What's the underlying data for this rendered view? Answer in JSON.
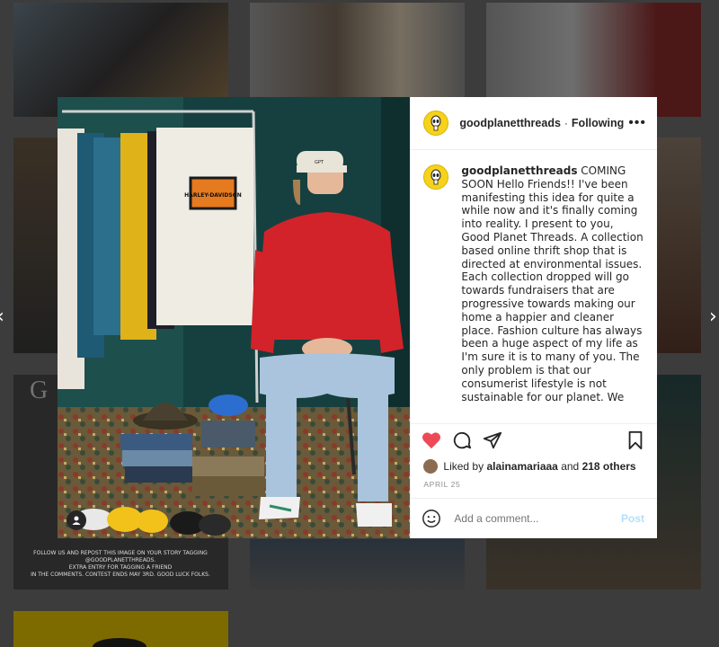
{
  "post": {
    "username": "goodplanetthreads",
    "follow_label": "Following",
    "separator": "·",
    "more_icon": "•••",
    "caption": "COMING SOON Hello Friends!! I've been manifesting this idea for quite a while now and it's finally coming into reality. I present to you, Good Planet Threads. A collection based online thrift shop that is directed at environmental issues. Each collection dropped will go towards fundraisers that are progressive towards making our home a happier and cleaner place. Fashion culture has always been a huge aspect of my life as I'm sure it is to many of you. The only problem is that our consumerist lifestyle is not sustainable for our planet. We",
    "liked_by_prefix": "Liked by",
    "liked_by_user": "alainamariaaa",
    "liked_by_and": "and",
    "liked_by_others": "218 others",
    "date": "APRIL 25",
    "comment_placeholder": "Add a comment...",
    "post_label": "Post"
  },
  "photo": {
    "shirt_logo": "HARLEY-DAVIDSON",
    "hat_text": "GPT"
  },
  "background": {
    "promo_line1": "FOLLOW US AND REPOST THIS IMAGE ON YOUR STORY TAGGING",
    "promo_line2": "@GOODPLANETTHREADS.",
    "promo_line3": "EXTRA ENTRY FOR TAGGING A FRIEND",
    "promo_line4": "IN THE COMMENTS. CONTEST ENDS MAY 3RD. GOOD LUCK FOLKS.",
    "nav_prev": "‹",
    "nav_next": "›",
    "tile_letter": "G"
  },
  "colors": {
    "like_red": "#ed4956",
    "avatar_yellow": "#f6d21a",
    "post_blue": "#b2dffc"
  }
}
